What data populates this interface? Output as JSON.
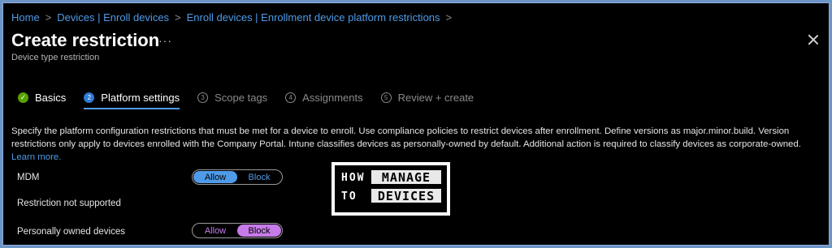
{
  "breadcrumb": [
    "Home",
    "Devices | Enroll devices",
    "Enroll devices | Enrollment device platform restrictions"
  ],
  "header": {
    "title": "Create restriction",
    "more": "···",
    "subtitle": "Device type restriction"
  },
  "steps": [
    {
      "num": "✓",
      "label": "Basics",
      "state": "done"
    },
    {
      "num": "2",
      "label": "Platform settings",
      "state": "current"
    },
    {
      "num": "3",
      "label": "Scope tags",
      "state": "pending"
    },
    {
      "num": "4",
      "label": "Assignments",
      "state": "pending"
    },
    {
      "num": "5",
      "label": "Review + create",
      "state": "pending"
    }
  ],
  "description": {
    "text": "Specify the platform configuration restrictions that must be met for a device to enroll. Use compliance policies to restrict devices after enrollment. Define versions as major.minor.build. Version restrictions only apply to devices enrolled with the Company Portal. Intune classifies devices as personally-owned by default. Additional action is required to classify devices as corporate-owned. ",
    "link": "Learn more."
  },
  "settings": {
    "mdm": {
      "label": "MDM",
      "allow": "Allow",
      "block": "Block",
      "selected": "Allow"
    },
    "restriction_note": "Restriction not supported",
    "personally_owned": {
      "label": "Personally owned devices",
      "allow": "Allow",
      "block": "Block",
      "selected": "Block"
    }
  },
  "logo": {
    "how": "HOW",
    "to": "TO",
    "manage": "MANAGE",
    "devices": "DEVICES"
  },
  "colors": {
    "accent": "#4f9be8",
    "done": "#57a300",
    "block_selected": "#c77be8",
    "background": "#000000"
  }
}
